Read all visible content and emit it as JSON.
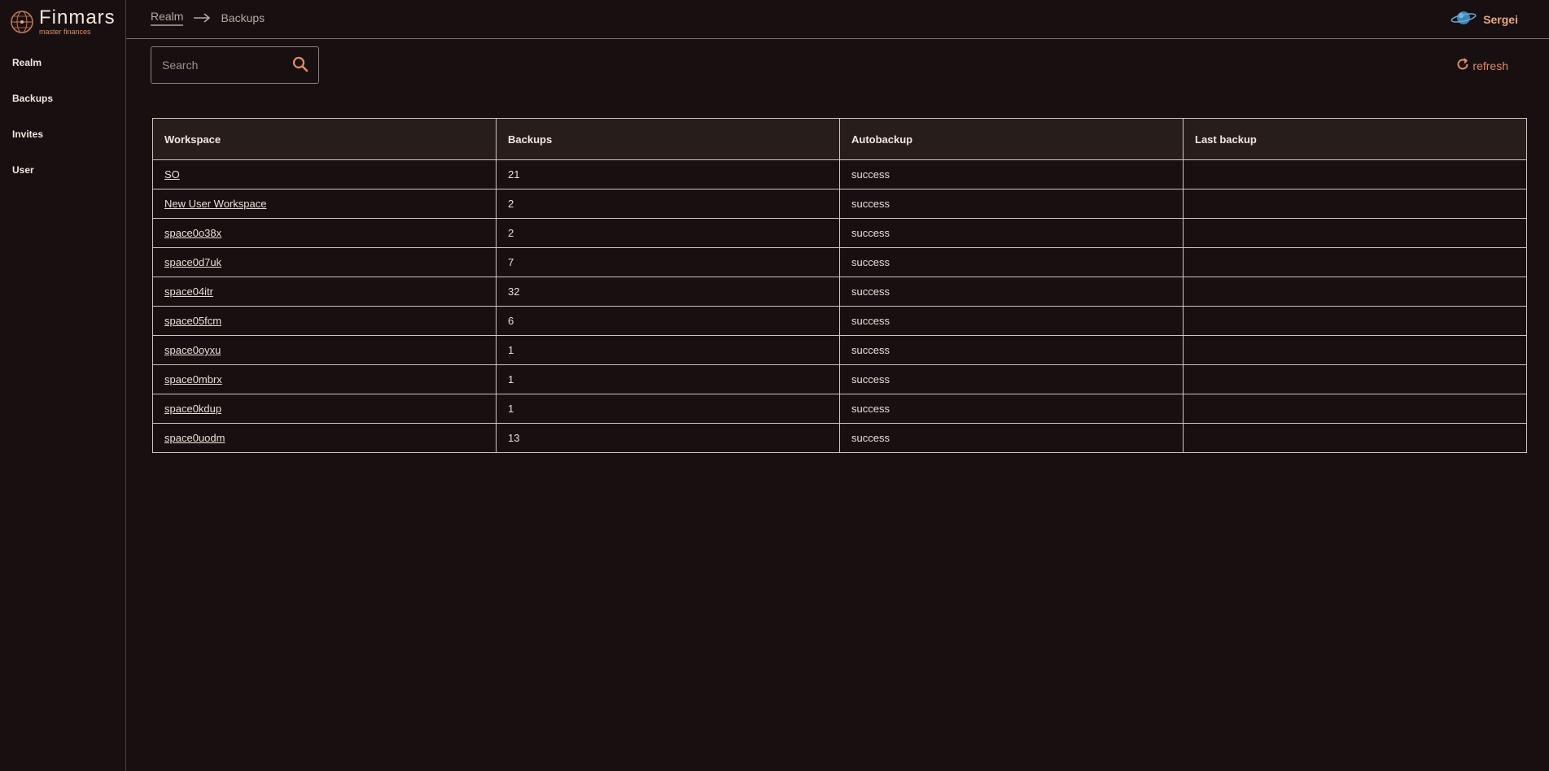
{
  "app": {
    "logo_title": "Finmars",
    "logo_subtitle": "master finances"
  },
  "sidebar": {
    "items": [
      {
        "label": "Realm"
      },
      {
        "label": "Backups"
      },
      {
        "label": "Invites"
      },
      {
        "label": "User"
      }
    ]
  },
  "header": {
    "breadcrumb_link": "Realm",
    "breadcrumb_current": "Backups",
    "user_name": "Sergei"
  },
  "search": {
    "placeholder": "Search",
    "value": ""
  },
  "toolbar": {
    "refresh_label": "refresh"
  },
  "table": {
    "headers": [
      "Workspace",
      "Backups",
      "Autobackup",
      "Last backup"
    ],
    "rows": [
      {
        "workspace": "SO",
        "backups": "21",
        "autobackup": "success",
        "last_backup": ""
      },
      {
        "workspace": "New User Workspace",
        "backups": "2",
        "autobackup": "success",
        "last_backup": ""
      },
      {
        "workspace": "space0o38x",
        "backups": "2",
        "autobackup": "success",
        "last_backup": ""
      },
      {
        "workspace": "space0d7uk",
        "backups": "7",
        "autobackup": "success",
        "last_backup": ""
      },
      {
        "workspace": "space04itr",
        "backups": "32",
        "autobackup": "success",
        "last_backup": ""
      },
      {
        "workspace": "space05fcm",
        "backups": "6",
        "autobackup": "success",
        "last_backup": ""
      },
      {
        "workspace": "space0oyxu",
        "backups": "1",
        "autobackup": "success",
        "last_backup": ""
      },
      {
        "workspace": "space0mbrx",
        "backups": "1",
        "autobackup": "success",
        "last_backup": ""
      },
      {
        "workspace": "space0kdup",
        "backups": "1",
        "autobackup": "success",
        "last_backup": ""
      },
      {
        "workspace": "space0uodm",
        "backups": "13",
        "autobackup": "success",
        "last_backup": ""
      }
    ]
  },
  "colors": {
    "background": "#181010",
    "accent": "#e48b6a",
    "header_row": "#271d1b"
  },
  "icons": {
    "logo": "globe-logo-icon",
    "breadcrumb_separator": "arrow-right-icon",
    "avatar": "planet-avatar-icon",
    "search": "search-icon",
    "refresh": "refresh-icon"
  }
}
